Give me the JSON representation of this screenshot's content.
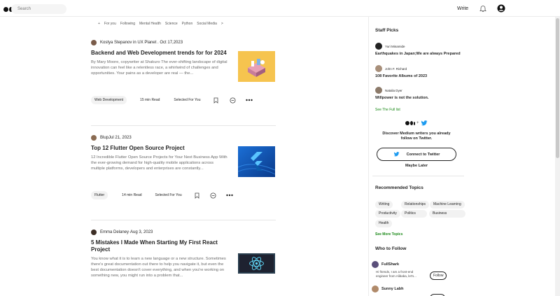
{
  "header": {
    "search_placeholder": "Search",
    "write_label": "Write"
  },
  "tabs": [
    "+",
    "For you",
    "Following",
    "Mental Health",
    "Science",
    "Python",
    "Social Media",
    ">"
  ],
  "articles": [
    {
      "author": "Kostya Stepanov in UX Planet . Oct 17,2023",
      "title": "Backend and Web Development trends for for 2024",
      "excerpt": "By Mary Moore, copywriter at Shakuro The ever-shifting landscape of digital innovation can feel like a relentless race, a whirlwind of challenges and opportunities. Your pains as a developer are real — the...",
      "tag": "Web Development",
      "read_time": "15 min Read",
      "selected": "Selected For You"
    },
    {
      "author": "BlupJul 21, 2023",
      "title": "Top 12 Flutter Open Source Project",
      "excerpt": "12 Incredible Flutter Open Source Projects for Your Next Business App With the ever-growing demand for high-quality mobile applications across multiple platforms, developers and enterprises are constantly...",
      "tag": "Flutter",
      "read_time": "14 min Read",
      "selected": "Selected For You"
    },
    {
      "author": "Emma Delaney·Aug 3, 2023",
      "title": "5 Mistakes I Made When Starting My First React Project",
      "excerpt": "You know what it is to learn a new language or a new structure. Sometimes there's great documentation out there to help you navigate it, but even the best documentation doesn't cover everything, and when you're working on something new, you might run into a problem that..."
    }
  ],
  "sidebar": {
    "staff_picks_heading": "Staff Picks",
    "picks": [
      {
        "author": "Yuri Minamide",
        "title": "Earthquakes in Japan;We are always Prepared"
      },
      {
        "author": "John F. Richard",
        "title": "108 Favorite Albums of 2023"
      },
      {
        "author": "Natalia Dyer",
        "title": "Willpower is not the solution."
      }
    ],
    "full_list_label": "See The Full list",
    "discover_text_1": "Discover Medium writers you already",
    "discover_text_2": "follow on Twitter.",
    "connect_twitter_label": "Connect to Twitter",
    "maybe_later_label": "Maybe Later",
    "recommended_heading": "Recommended Topics",
    "topics": [
      "Writing",
      "Relationships",
      "Machine Learning",
      "Productivity",
      "Politics",
      "Business",
      "Health"
    ],
    "more_topics_label": "See More Topics",
    "who_to_follow_heading": "Who to Follow",
    "follow": [
      {
        "name": "FullShark",
        "bio_1": "Hi friends, I am a front-end",
        "bio_2": "engineer from Alibaba, let's...",
        "button": "Follow"
      },
      {
        "name": "Sunny Labh"
      }
    ]
  },
  "colors": {
    "accent_green": "#1a8917",
    "twitter_blue": "#1d9bf0"
  }
}
